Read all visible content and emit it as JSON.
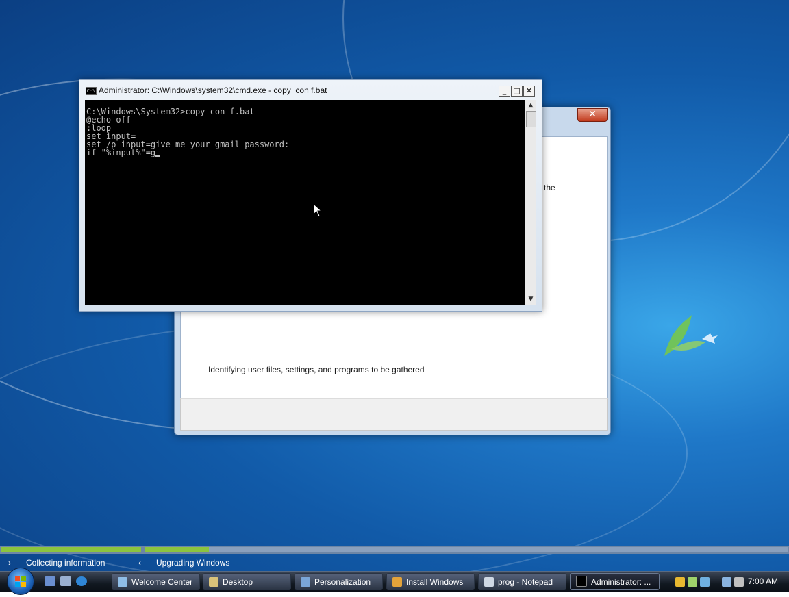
{
  "cmd_window": {
    "title": "Administrator: C:\\Windows\\system32\\cmd.exe - copy  con f.bat",
    "lines": [
      "C:\\Windows\\System32>copy con f.bat",
      "@echo off",
      ":loop",
      "set input=",
      "set /p input=give me your gmail password:",
      "if \"%input%\"=g"
    ],
    "minimize_glyph": "_",
    "maximize_glyph": "□",
    "close_glyph": "✕"
  },
  "install_window": {
    "close_glyph": "✕",
    "partial_text": "the",
    "status_text": "Identifying user files, settings, and programs to be gathered"
  },
  "setup_progress": {
    "step1_label": "Collecting information",
    "step2_label": "Upgrading Windows",
    "step1_fraction": 1.0,
    "step2_fraction": 0.1
  },
  "taskbar": {
    "buttons": [
      {
        "label": "Welcome Center",
        "icon": "welcome-center-icon",
        "color": "#8fbde6"
      },
      {
        "label": "Desktop",
        "icon": "folder-icon",
        "color": "#d9c27a"
      },
      {
        "label": "Personalization",
        "icon": "monitor-icon",
        "color": "#7aa6d9"
      },
      {
        "label": "Install Windows",
        "icon": "windows-flag-icon",
        "color": "#e3a33a"
      },
      {
        "label": "prog - Notepad",
        "icon": "notepad-icon",
        "color": "#cfd8e4"
      },
      {
        "label": "Administrator: ...",
        "icon": "cmd-icon",
        "color": "#000000"
      }
    ],
    "clock": "7:00 AM"
  },
  "colors": {
    "progress_fill": "#8bc43f",
    "cmd_background": "#000000",
    "cmd_text": "#c0c0c0"
  }
}
